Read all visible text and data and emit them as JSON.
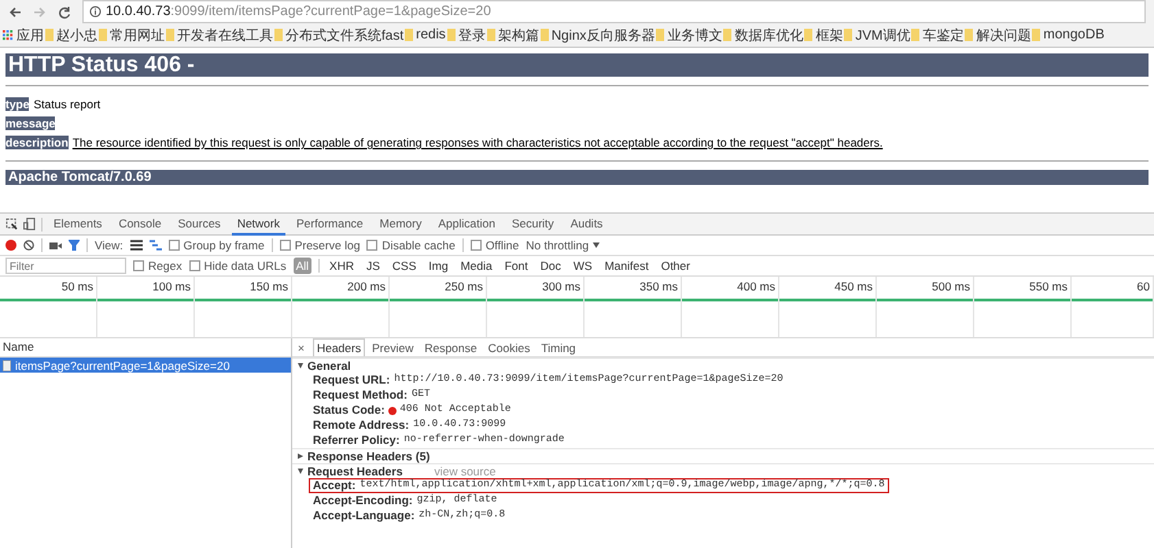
{
  "address_bar": {
    "host": "10.0.40.73",
    "path": ":9099/item/itemsPage?currentPage=1&pageSize=20"
  },
  "bookmarks": [
    {
      "label": "应用",
      "kind": "apps"
    },
    {
      "label": "赵小忠",
      "kind": "folder"
    },
    {
      "label": "常用网址",
      "kind": "folder"
    },
    {
      "label": "开发者在线工具",
      "kind": "folder"
    },
    {
      "label": "分布式文件系统fast",
      "kind": "folder"
    },
    {
      "label": "redis",
      "kind": "folder"
    },
    {
      "label": "登录",
      "kind": "folder"
    },
    {
      "label": "架构篇",
      "kind": "folder"
    },
    {
      "label": "Nginx反向服务器",
      "kind": "folder"
    },
    {
      "label": "业务博文",
      "kind": "folder"
    },
    {
      "label": "数据库优化",
      "kind": "folder"
    },
    {
      "label": "框架",
      "kind": "folder"
    },
    {
      "label": "JVM调优",
      "kind": "folder"
    },
    {
      "label": "车鉴定",
      "kind": "folder"
    },
    {
      "label": "解决问题",
      "kind": "folder"
    },
    {
      "label": "mongoDB",
      "kind": "folder"
    }
  ],
  "page": {
    "heading": "HTTP Status 406 -",
    "fields": [
      {
        "label": "type",
        "text": "Status report",
        "link": false
      },
      {
        "label": "message"
      },
      {
        "label": "description",
        "text": "The resource identified by this request is only capable of generating responses with characteristics not acceptable according to the request \"accept\" headers.",
        "link": true
      }
    ],
    "footer": "Apache Tomcat/7.0.69"
  },
  "devtools": {
    "tabs": [
      {
        "label": "Elements",
        "selected": false
      },
      {
        "label": "Console",
        "selected": false
      },
      {
        "label": "Sources",
        "selected": false
      },
      {
        "label": "Network",
        "selected": true
      },
      {
        "label": "Performance",
        "selected": false
      },
      {
        "label": "Memory",
        "selected": false
      },
      {
        "label": "Application",
        "selected": false
      },
      {
        "label": "Security",
        "selected": false
      },
      {
        "label": "Audits",
        "selected": false
      }
    ],
    "toolbar": {
      "recording": true,
      "filter_active": true,
      "view_label": "View:",
      "checkboxes": [
        {
          "label": "Group by frame",
          "checked": false
        },
        {
          "label": "Preserve log",
          "checked": false
        },
        {
          "label": "Disable cache",
          "checked": false
        },
        {
          "label": "Offline",
          "checked": false
        }
      ],
      "throttling": "No throttling"
    },
    "filter": {
      "placeholder": "Filter",
      "checkboxes": [
        {
          "label": "Regex",
          "checked": false
        },
        {
          "label": "Hide data URLs",
          "checked": false
        }
      ],
      "types": [
        {
          "label": "All",
          "selected": true
        },
        {
          "label": "XHR",
          "selected": false
        },
        {
          "label": "JS",
          "selected": false
        },
        {
          "label": "CSS",
          "selected": false
        },
        {
          "label": "Img",
          "selected": false
        },
        {
          "label": "Media",
          "selected": false
        },
        {
          "label": "Font",
          "selected": false
        },
        {
          "label": "Doc",
          "selected": false
        },
        {
          "label": "WS",
          "selected": false
        },
        {
          "label": "Manifest",
          "selected": false
        },
        {
          "label": "Other",
          "selected": false
        }
      ]
    },
    "timeline": [
      "50 ms",
      "100 ms",
      "150 ms",
      "200 ms",
      "250 ms",
      "300 ms",
      "350 ms",
      "400 ms",
      "450 ms",
      "500 ms",
      "550 ms",
      "60"
    ],
    "requests": {
      "header": "Name",
      "rows": [
        {
          "name": "itemsPage?currentPage=1&pageSize=20",
          "selected": true
        }
      ]
    },
    "detail": {
      "close": "×",
      "tabs": [
        {
          "label": "Headers",
          "selected": true
        },
        {
          "label": "Preview",
          "selected": false
        },
        {
          "label": "Response",
          "selected": false
        },
        {
          "label": "Cookies",
          "selected": false
        },
        {
          "label": "Timing",
          "selected": false
        }
      ],
      "sections": [
        {
          "title": "General",
          "expanded": true,
          "rows": [
            {
              "key": "Request URL:",
              "value": "http://10.0.40.73:9099/item/itemsPage?currentPage=1&pageSize=20",
              "highlighted": false
            },
            {
              "key": "Request Method:",
              "value": "GET",
              "highlighted": false
            },
            {
              "key": "Status Code:",
              "value": "406 Not Acceptable",
              "color": "#e0201b",
              "highlighted": false
            },
            {
              "key": "Remote Address:",
              "value": "10.0.40.73:9099",
              "highlighted": false
            },
            {
              "key": "Referrer Policy:",
              "value": "no-referrer-when-downgrade",
              "highlighted": false
            }
          ]
        },
        {
          "title": "Response Headers (5)",
          "expanded": false
        },
        {
          "title": "Request Headers",
          "link": "view source",
          "expanded": true,
          "rows": [
            {
              "key": "Accept:",
              "value": "text/html,application/xhtml+xml,application/xml;q=0.9,image/webp,image/apng,*/*;q=0.8",
              "highlighted": true
            },
            {
              "key": "Accept-Encoding:",
              "value": "gzip, deflate",
              "highlighted": false
            },
            {
              "key": "Accept-Language:",
              "value": "zh-CN,zh;q=0.8",
              "highlighted": false
            }
          ]
        }
      ]
    }
  }
}
